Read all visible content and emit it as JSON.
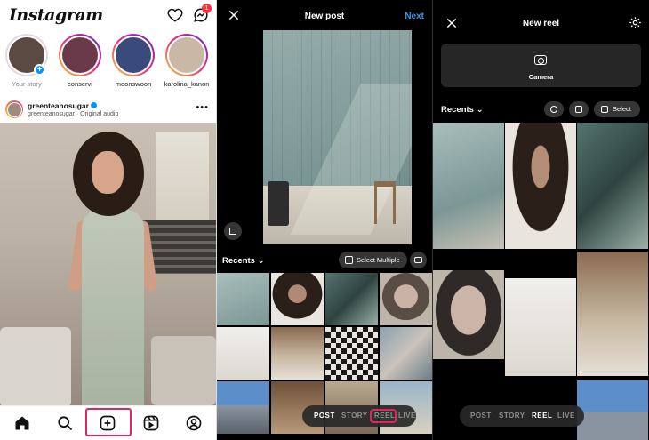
{
  "feed": {
    "logo": "Instagram",
    "notification_count": "1",
    "stories": [
      {
        "name": "Your story",
        "own": true,
        "color": "#5b4a42"
      },
      {
        "name": "conservi",
        "own": false,
        "color": "#6b3a4a"
      },
      {
        "name": "moonswoon",
        "own": false,
        "color": "#3a4a7a"
      },
      {
        "name": "karolina_kanon",
        "own": false,
        "color": "#c9b8a6"
      }
    ],
    "post": {
      "username": "greenteanosugar",
      "subtitle": "greenteanosugar · Original audio"
    }
  },
  "new_post": {
    "title": "New post",
    "next_label": "Next",
    "recents_label": "Recents",
    "select_multiple_label": "Select Multiple",
    "modes": [
      {
        "label": "POST",
        "active": true
      },
      {
        "label": "STORY",
        "active": false
      },
      {
        "label": "REEL",
        "active": false
      },
      {
        "label": "LIVE",
        "active": false
      }
    ]
  },
  "new_reel": {
    "title": "New reel",
    "camera_label": "Camera",
    "recents_label": "Recents",
    "select_label": "Select",
    "modes": [
      {
        "label": "POST",
        "active": false
      },
      {
        "label": "STORY",
        "active": false
      },
      {
        "label": "REEL",
        "active": true
      },
      {
        "label": "LIVE",
        "active": false
      }
    ]
  },
  "colors": {
    "accent_blue": "#3897f0",
    "highlight_pink": "#e0245e",
    "badge_red": "#ff3040"
  }
}
